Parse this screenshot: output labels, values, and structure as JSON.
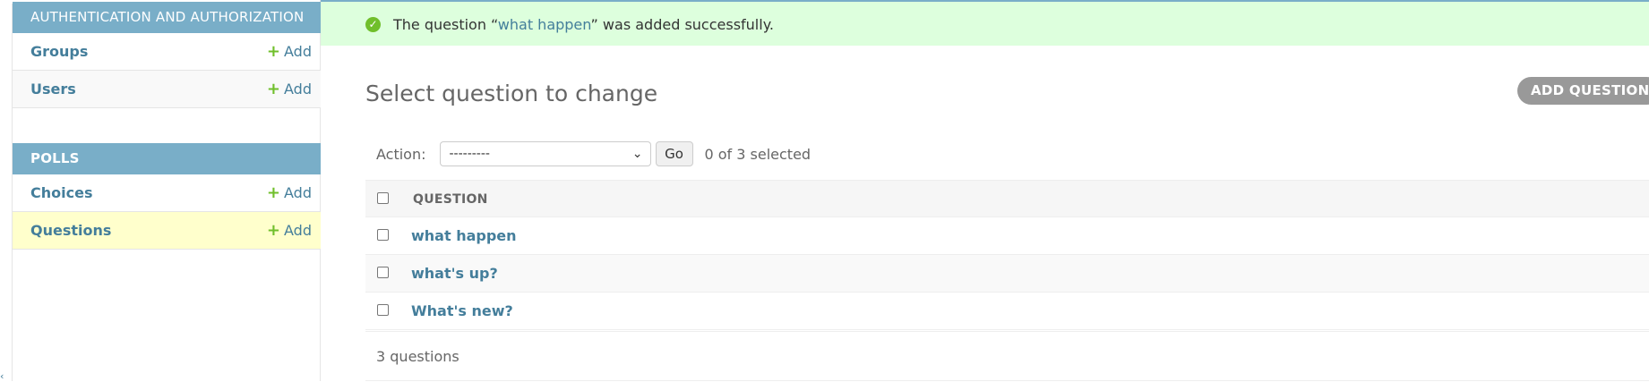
{
  "sidebar": {
    "modules": [
      {
        "header": "AUTHENTICATION AND AUTHORIZATION",
        "items": [
          {
            "label": "Groups",
            "add": "Add"
          },
          {
            "label": "Users",
            "add": "Add"
          }
        ]
      },
      {
        "header": "POLLS",
        "items": [
          {
            "label": "Choices",
            "add": "Add"
          },
          {
            "label": "Questions",
            "add": "Add",
            "current": true
          }
        ]
      }
    ]
  },
  "message": {
    "prefix": "The question “",
    "link": "what happen",
    "suffix": "” was added successfully."
  },
  "page_title": "Select question to change",
  "add_button": "ADD QUESTION +",
  "actions": {
    "label": "Action:",
    "selected_option": "---------",
    "go": "Go",
    "count": "0 of 3 selected"
  },
  "table": {
    "column": "QUESTION",
    "rows": [
      "what happen",
      "what's up?",
      "What's new?"
    ]
  },
  "footer": "3 questions",
  "colors": {
    "header_blue": "#79aec8",
    "link_blue": "#447e9b",
    "success_bg": "#dfd",
    "add_green": "#70bf2b",
    "current_row": "#ffffcc"
  }
}
